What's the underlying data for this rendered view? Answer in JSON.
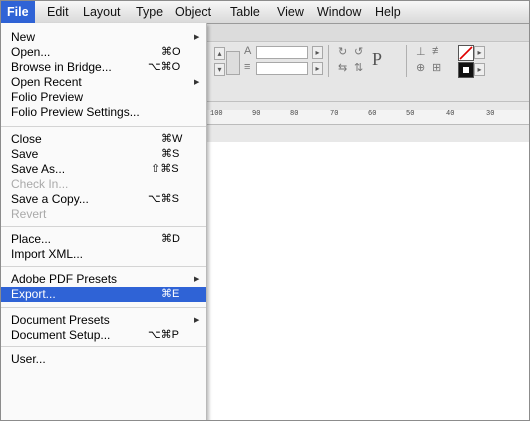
{
  "menubar": [
    "File",
    "Edit",
    "Layout",
    "Type",
    "Object",
    "Table",
    "View",
    "Window",
    "Help"
  ],
  "file_menu": {
    "items": [
      {
        "label": "New",
        "shortcut": "",
        "submenu": true
      },
      {
        "label": "Open...",
        "shortcut": "⌘O"
      },
      {
        "label": "Browse in Bridge...",
        "shortcut": "⌥⌘O"
      },
      {
        "label": "Open Recent",
        "shortcut": "",
        "submenu": true
      },
      {
        "label": "Folio Preview",
        "shortcut": ""
      },
      {
        "label": "Folio Preview Settings...",
        "shortcut": ""
      },
      {
        "label": "Close",
        "shortcut": "⌘W"
      },
      {
        "label": "Save",
        "shortcut": "⌘S"
      },
      {
        "label": "Save As...",
        "shortcut": "⇧⌘S"
      },
      {
        "label": "Check In...",
        "shortcut": "",
        "disabled": true
      },
      {
        "label": "Save a Copy...",
        "shortcut": "⌥⌘S"
      },
      {
        "label": "Revert",
        "shortcut": "",
        "disabled": true
      },
      {
        "label": "Place...",
        "shortcut": "⌘D"
      },
      {
        "label": "Import XML...",
        "shortcut": ""
      },
      {
        "label": "Adobe PDF Presets",
        "shortcut": "",
        "submenu": true
      },
      {
        "label": "Export...",
        "shortcut": "⌘E",
        "highlighted": true
      },
      {
        "label": "Document Presets",
        "shortcut": "",
        "submenu": true
      },
      {
        "label": "Document Setup...",
        "shortcut": "⌥⌘P"
      },
      {
        "label": "User...",
        "shortcut": ""
      }
    ]
  },
  "ruler": [
    "100",
    "90",
    "80",
    "70",
    "60",
    "50",
    "40",
    "30"
  ],
  "icons": {
    "submenu_arrow": "▶"
  }
}
